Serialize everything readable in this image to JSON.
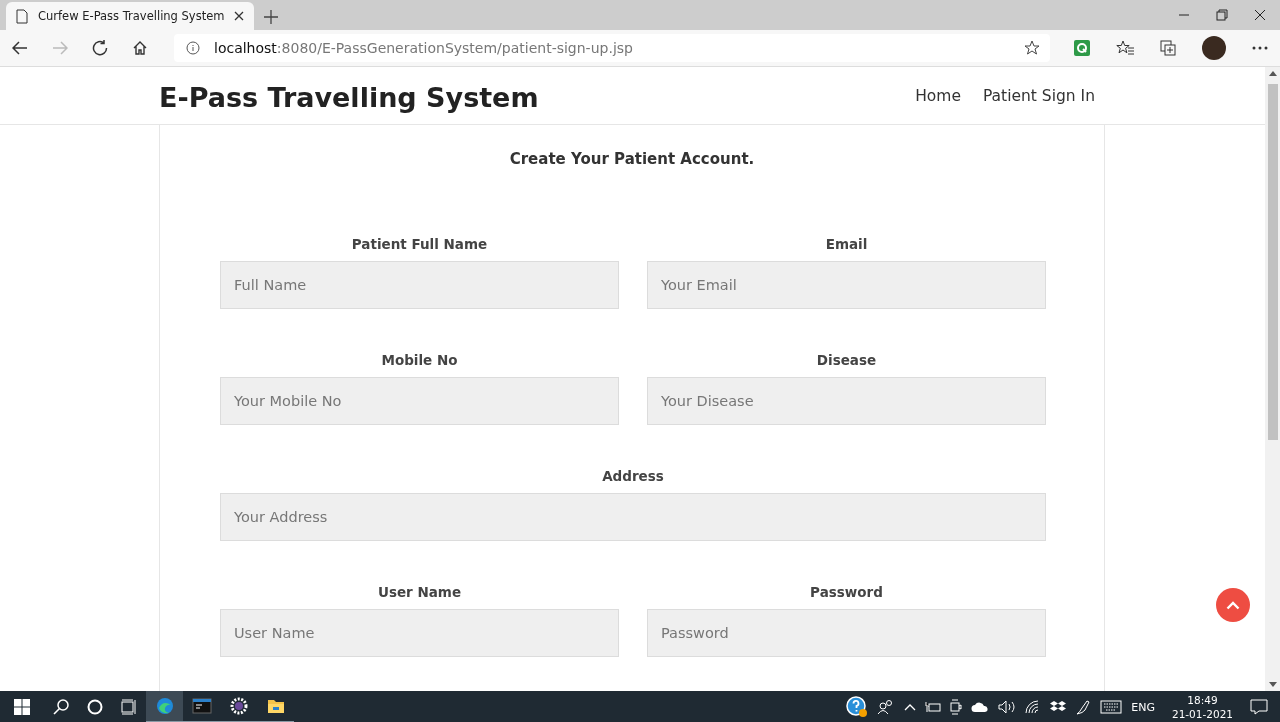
{
  "browser": {
    "tab_title": "Curfew E-Pass Travelling System",
    "url_host": "localhost",
    "url_path": ":8080/E-PassGenerationSystem/patient-sign-up.jsp"
  },
  "header": {
    "brand": "E-Pass Travelling System",
    "nav": [
      "Home",
      "Patient Sign In"
    ]
  },
  "form": {
    "heading": "Create Your Patient Account.",
    "fields": [
      {
        "label": "Patient Full Name",
        "placeholder": "Full Name",
        "kind": "half"
      },
      {
        "label": "Email",
        "placeholder": "Your Email",
        "kind": "half"
      },
      {
        "label": "Mobile No",
        "placeholder": "Your Mobile No",
        "kind": "half"
      },
      {
        "label": "Disease",
        "placeholder": "Your Disease",
        "kind": "half"
      },
      {
        "label": "Address",
        "placeholder": "Your Address",
        "kind": "full"
      },
      {
        "label": "User Name",
        "placeholder": "User Name",
        "kind": "half"
      },
      {
        "label": "Password",
        "placeholder": "Password",
        "kind": "half"
      }
    ]
  },
  "taskbar": {
    "apps": [
      {
        "kind": "edge",
        "selected": true
      },
      {
        "kind": "terminal",
        "selected": false
      },
      {
        "kind": "gear",
        "selected": false
      },
      {
        "kind": "folder",
        "selected": false
      }
    ],
    "language": "ENG",
    "time": "18:49",
    "date": "21-01-2021"
  }
}
